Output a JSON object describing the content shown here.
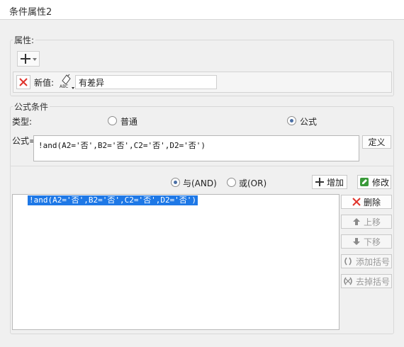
{
  "window": {
    "title": "条件属性2"
  },
  "properties": {
    "legend": "属性:",
    "new_value_label": "新值:",
    "type_icon_text": "ABC",
    "value": "有差异"
  },
  "formula_condition": {
    "legend": "公式条件",
    "type_label": "类型:",
    "type_options": [
      {
        "label": "普通",
        "checked": false
      },
      {
        "label": "公式",
        "checked": true
      }
    ],
    "formula_label": "公式=",
    "formula_value": "!and(A2='否',B2='否',C2='否',D2='否')",
    "define_button": "定义",
    "logic_options": [
      {
        "label": "与(AND)",
        "checked": true
      },
      {
        "label": "或(OR)",
        "checked": false
      }
    ],
    "add_button": "增加",
    "modify_button": "修改",
    "conditions": [
      "!and(A2='否',B2='否',C2='否',D2='否')"
    ],
    "side_buttons": {
      "delete": "删除",
      "up": "上移",
      "down": "下移",
      "add_bracket": "添加括号",
      "remove_bracket": "去掉括号"
    }
  },
  "colors": {
    "selection": "#1e78e6",
    "delete_red": "#e0342c",
    "modify_green": "#3a9a3a"
  }
}
